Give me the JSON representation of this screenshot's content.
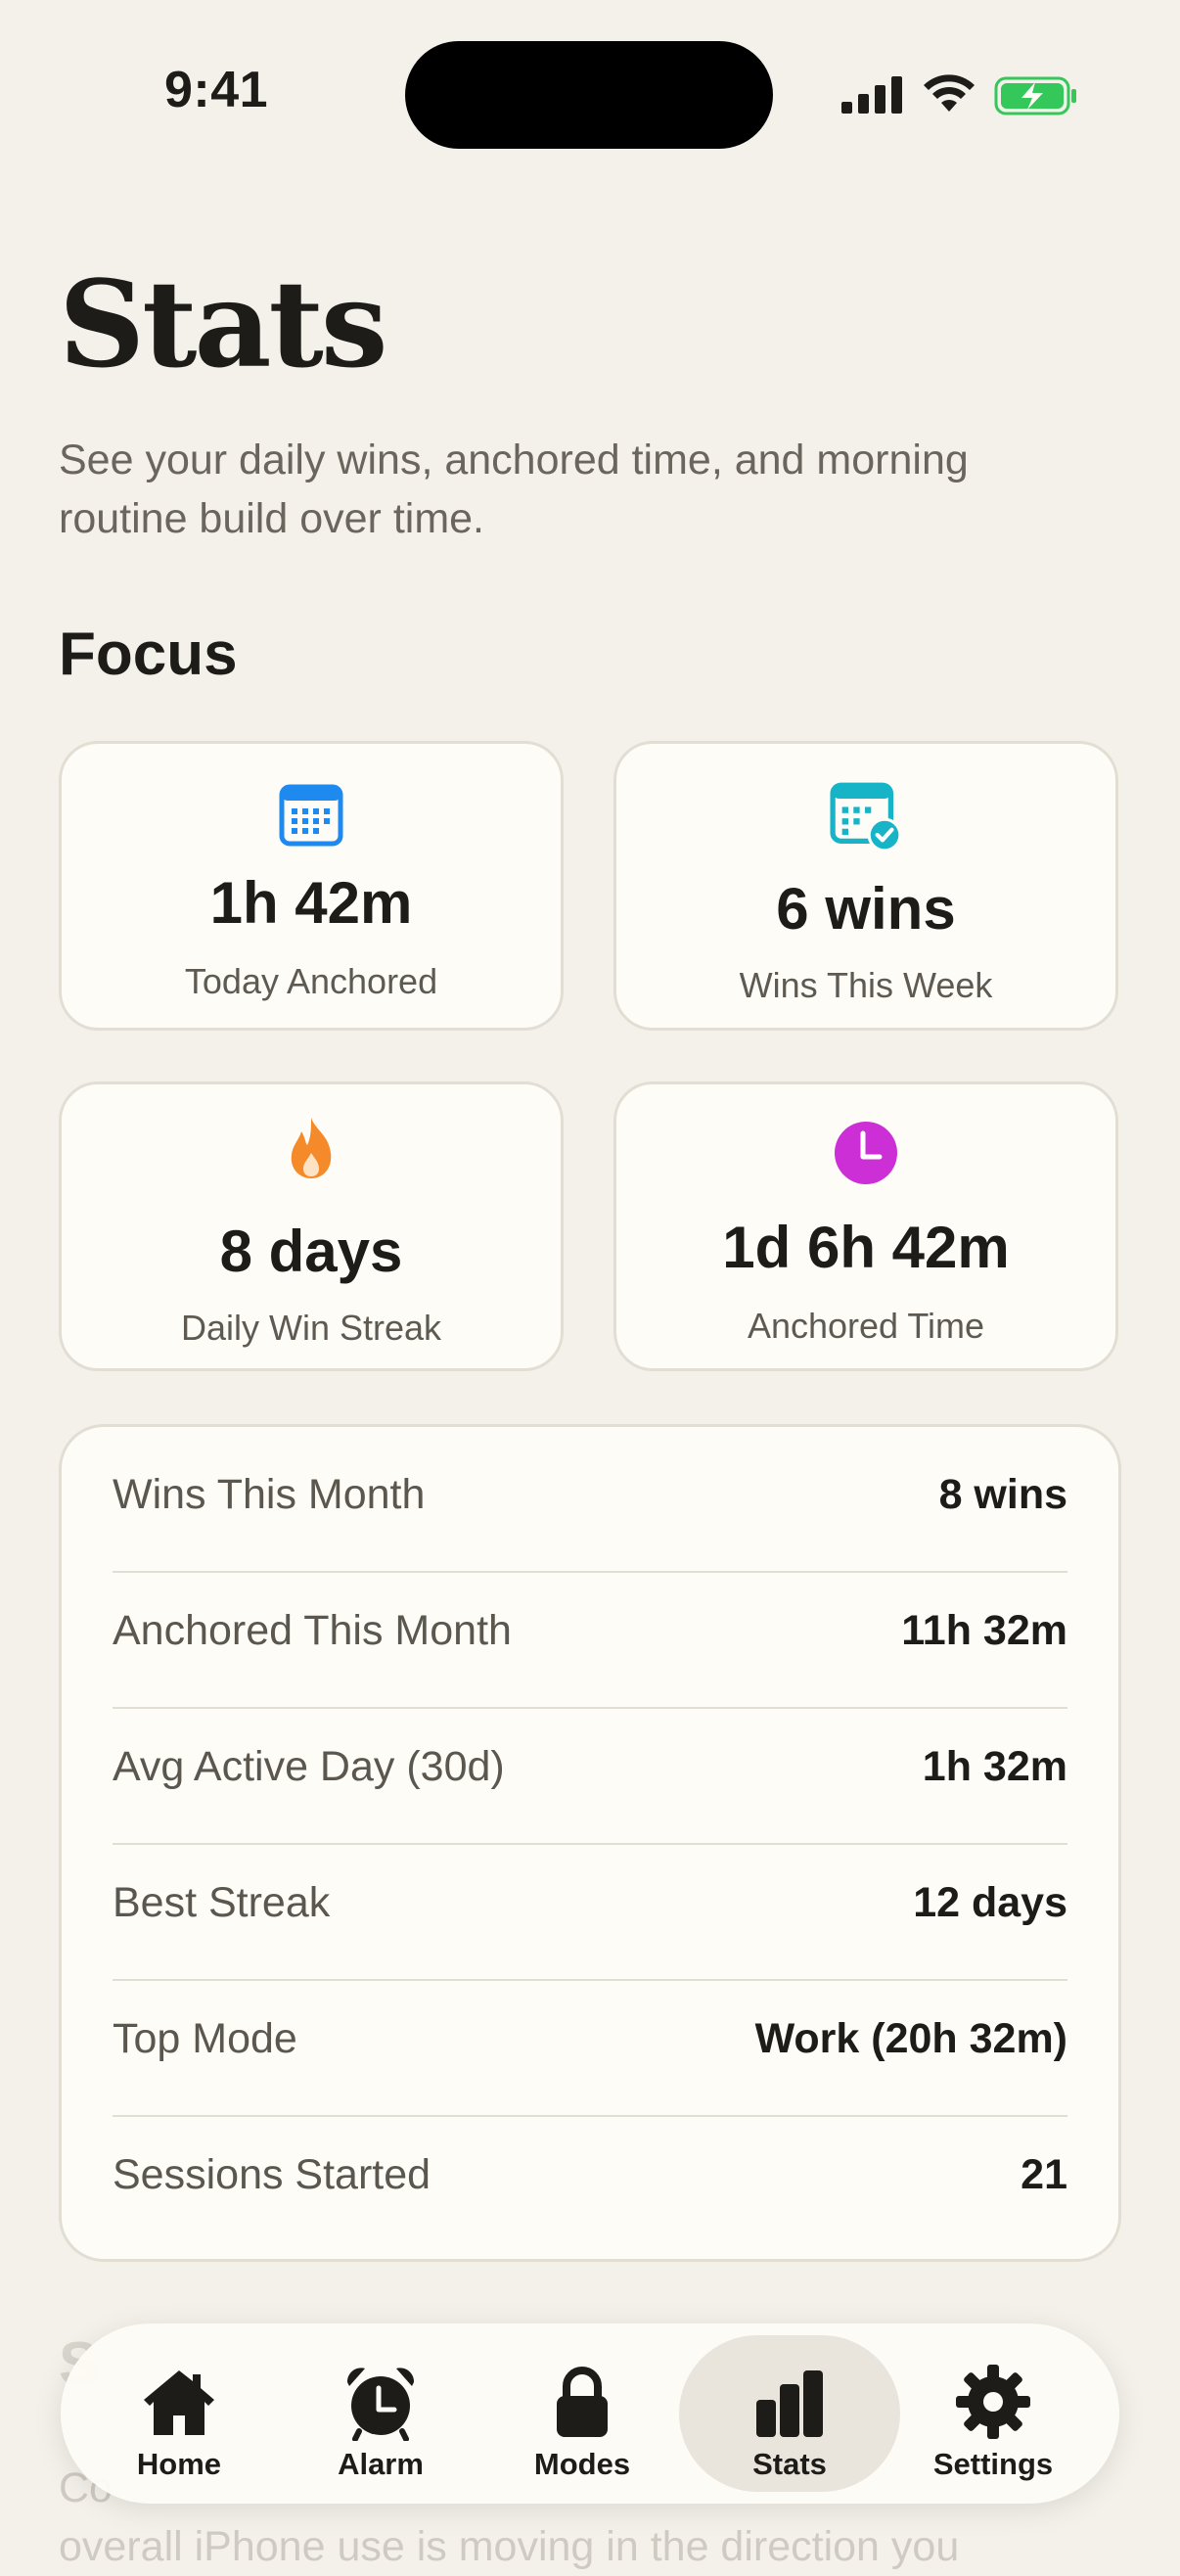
{
  "status_bar": {
    "time": "9:41"
  },
  "header": {
    "title": "Stats",
    "subtitle": "See your daily wins, anchored time, and morning routine build over time."
  },
  "focus": {
    "section_title": "Focus",
    "cards": [
      {
        "value": "1h 42m",
        "label": "Today Anchored",
        "icon": "calendar-icon",
        "color": "#1e8af0"
      },
      {
        "value": "6 wins",
        "label": "Wins This Week",
        "icon": "calendar-check-icon",
        "color": "#17b4c8"
      },
      {
        "value": "8 days",
        "label": "Daily Win Streak",
        "icon": "flame-icon",
        "color": "#f58a2a"
      },
      {
        "value": "1d 6h 42m",
        "label": "Anchored Time",
        "icon": "clock-icon",
        "color": "#cc2fd6"
      }
    ]
  },
  "stats": [
    {
      "label": "Wins This Month",
      "value": "8 wins"
    },
    {
      "label": "Anchored This Month",
      "value": "11h 32m"
    },
    {
      "label": "Avg Active Day (30d)",
      "value": "1h 32m"
    },
    {
      "label": "Best Streak",
      "value": "12 days"
    },
    {
      "label": "Top Mode",
      "value": "Work (20h 32m)"
    },
    {
      "label": "Sessions Started",
      "value": "21"
    }
  ],
  "next_section": {
    "title_partial": "S",
    "text_line1": "Co",
    "text_line2": "overall iPhone use is moving in the direction you"
  },
  "tabs": [
    {
      "label": "Home",
      "icon": "home-icon",
      "active": false
    },
    {
      "label": "Alarm",
      "icon": "alarm-clock-icon",
      "active": false
    },
    {
      "label": "Modes",
      "icon": "lock-icon",
      "active": false
    },
    {
      "label": "Stats",
      "icon": "bar-chart-icon",
      "active": true
    },
    {
      "label": "Settings",
      "icon": "gear-icon",
      "active": false
    }
  ]
}
